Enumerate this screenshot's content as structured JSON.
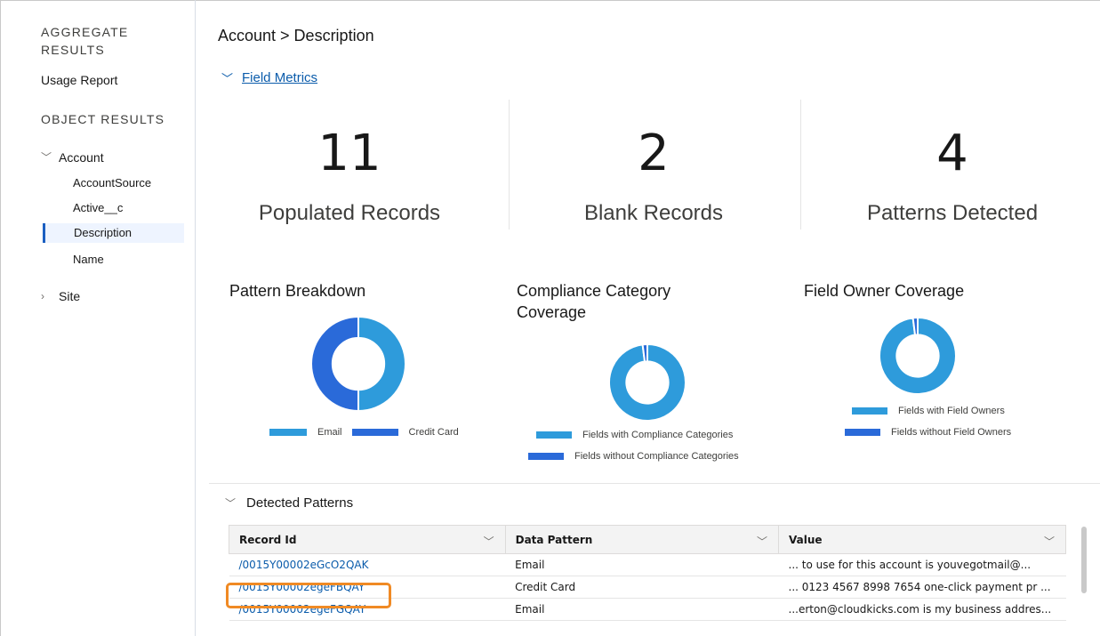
{
  "sidebar": {
    "aggregate_heading": "AGGREGATE RESULTS",
    "usage_report": "Usage Report",
    "object_heading": "OBJECT RESULTS",
    "account": "Account",
    "children": [
      "AccountSource",
      "Active__c",
      "Description",
      "Name"
    ],
    "selected_child": "Description",
    "site": "Site"
  },
  "main": {
    "title": "Account > Description",
    "field_metrics_label": "Field Metrics",
    "metrics": [
      {
        "value": "11",
        "label": "Populated Records"
      },
      {
        "value": "2",
        "label": "Blank Records"
      },
      {
        "value": "4",
        "label": "Patterns Detected"
      }
    ]
  },
  "charts": {
    "accent_light": "#2e9bdb",
    "accent_dark": "#2a6ad9"
  },
  "chart_data": [
    {
      "type": "pie",
      "title": "Pattern Breakdown",
      "categories": [
        "Email",
        "Credit Card"
      ],
      "values": [
        50,
        50
      ]
    },
    {
      "type": "pie",
      "title": "Compliance Category Coverage",
      "categories": [
        "Fields with Compliance Categories",
        "Fields without Compliance Categories"
      ],
      "values": [
        98,
        2
      ]
    },
    {
      "type": "pie",
      "title": "Field Owner Coverage",
      "categories": [
        "Fields with Field Owners",
        "Fields without Field Owners"
      ],
      "values": [
        98,
        2
      ]
    }
  ],
  "detected_patterns": {
    "label": "Detected Patterns",
    "columns": [
      "Record Id",
      "Data Pattern",
      "Value"
    ],
    "rows": [
      {
        "record_id": "/0015Y00002eGcO2QAK",
        "pattern": "Email",
        "value": "... to use for this account is youvegotmail@..."
      },
      {
        "record_id": "/0015Y00002egeFBQAY",
        "pattern": "Credit Card",
        "value": "... 0123 4567 8998 7654 one-click payment pr ..."
      },
      {
        "record_id": "/0015Y00002egeFGQAY",
        "pattern": "Email",
        "value": "...erton@cloudkicks.com is my business addres..."
      }
    ]
  }
}
